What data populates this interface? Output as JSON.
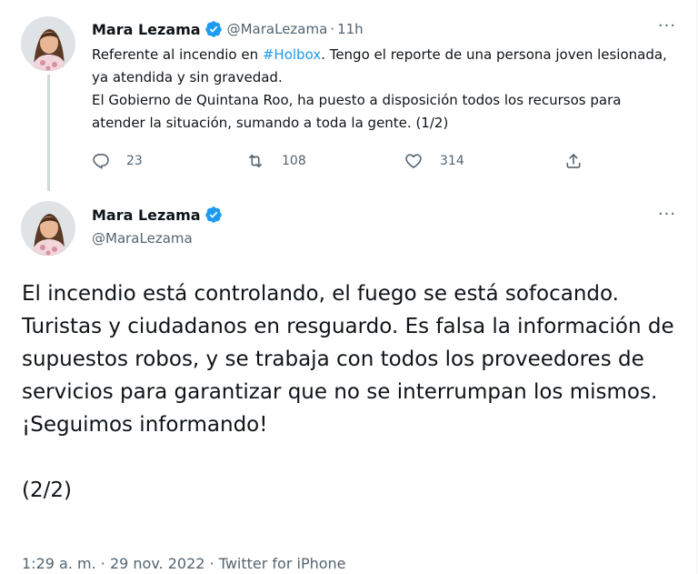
{
  "tweet1": {
    "author_name": "Mara Lezama",
    "handle": "@MaraLezama",
    "separator": "·",
    "time": "11h",
    "more_label": "···",
    "text_before_hashtag": "Referente al incendio en ",
    "hashtag": "#Holbox",
    "text_after_hashtag": ". Tengo el reporte de una persona joven lesionada, ya atendida y sin gravedad.",
    "text_second_paragraph": "El Gobierno de Quintana Roo, ha puesto a disposición todos los recursos para atender la situación, sumando a toda la gente. (1/2)",
    "replies": "23",
    "retweets": "108",
    "likes": "314"
  },
  "tweet2": {
    "author_name": "Mara Lezama",
    "handle": "@MaraLezama",
    "more_label": "···",
    "paragraph1": "El incendio está controlando, el fuego se está sofocando. Turistas y ciudadanos en resguardo. Es falsa la información de supuestos robos, y se trabaja con todos los proveedores de servicios para garantizar que no se interrumpan los mismos.",
    "paragraph2": "¡Seguimos informando!",
    "paragraph3": "(2/2)",
    "time": "1:29 a. m.",
    "date": "29 nov. 2022",
    "source": "Twitter for iPhone",
    "meta_separator": " · "
  },
  "icons": {
    "verified": "verified-badge-icon",
    "reply": "reply-icon",
    "retweet": "retweet-icon",
    "like": "heart-icon",
    "share": "share-icon",
    "more": "more-icon"
  },
  "colors": {
    "accent": "#1d9bf0",
    "secondary_text": "#536471",
    "primary_text": "#0f1419",
    "thread_line": "#cfd9de"
  }
}
